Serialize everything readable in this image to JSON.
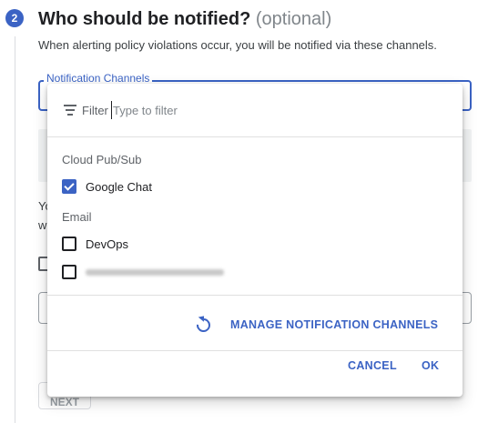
{
  "step": {
    "number": "2",
    "title": "Who should be notified?",
    "optional": "(optional)",
    "description": "When alerting policy violations occur, you will be notified via these channels."
  },
  "field": {
    "label": "Notification Channels"
  },
  "background": {
    "fragment_1": "Yo",
    "fragment_2": "w",
    "next_label": "NEXT"
  },
  "dropdown": {
    "filter_label": "Filter",
    "filter_placeholder": "Type to filter",
    "groups": [
      {
        "name": "Cloud Pub/Sub",
        "options": [
          {
            "label": "Google Chat",
            "checked": true
          }
        ]
      },
      {
        "name": "Email",
        "options": [
          {
            "label": "DevOps",
            "checked": false
          },
          {
            "label": "",
            "checked": false,
            "redacted": true
          }
        ]
      }
    ],
    "manage_label": "MANAGE NOTIFICATION CHANNELS",
    "manage_icon": "refresh-icon",
    "cancel_label": "CANCEL",
    "ok_label": "OK"
  },
  "colors": {
    "accent": "#3b63c4",
    "text": "#202124",
    "muted": "#5f6368"
  }
}
